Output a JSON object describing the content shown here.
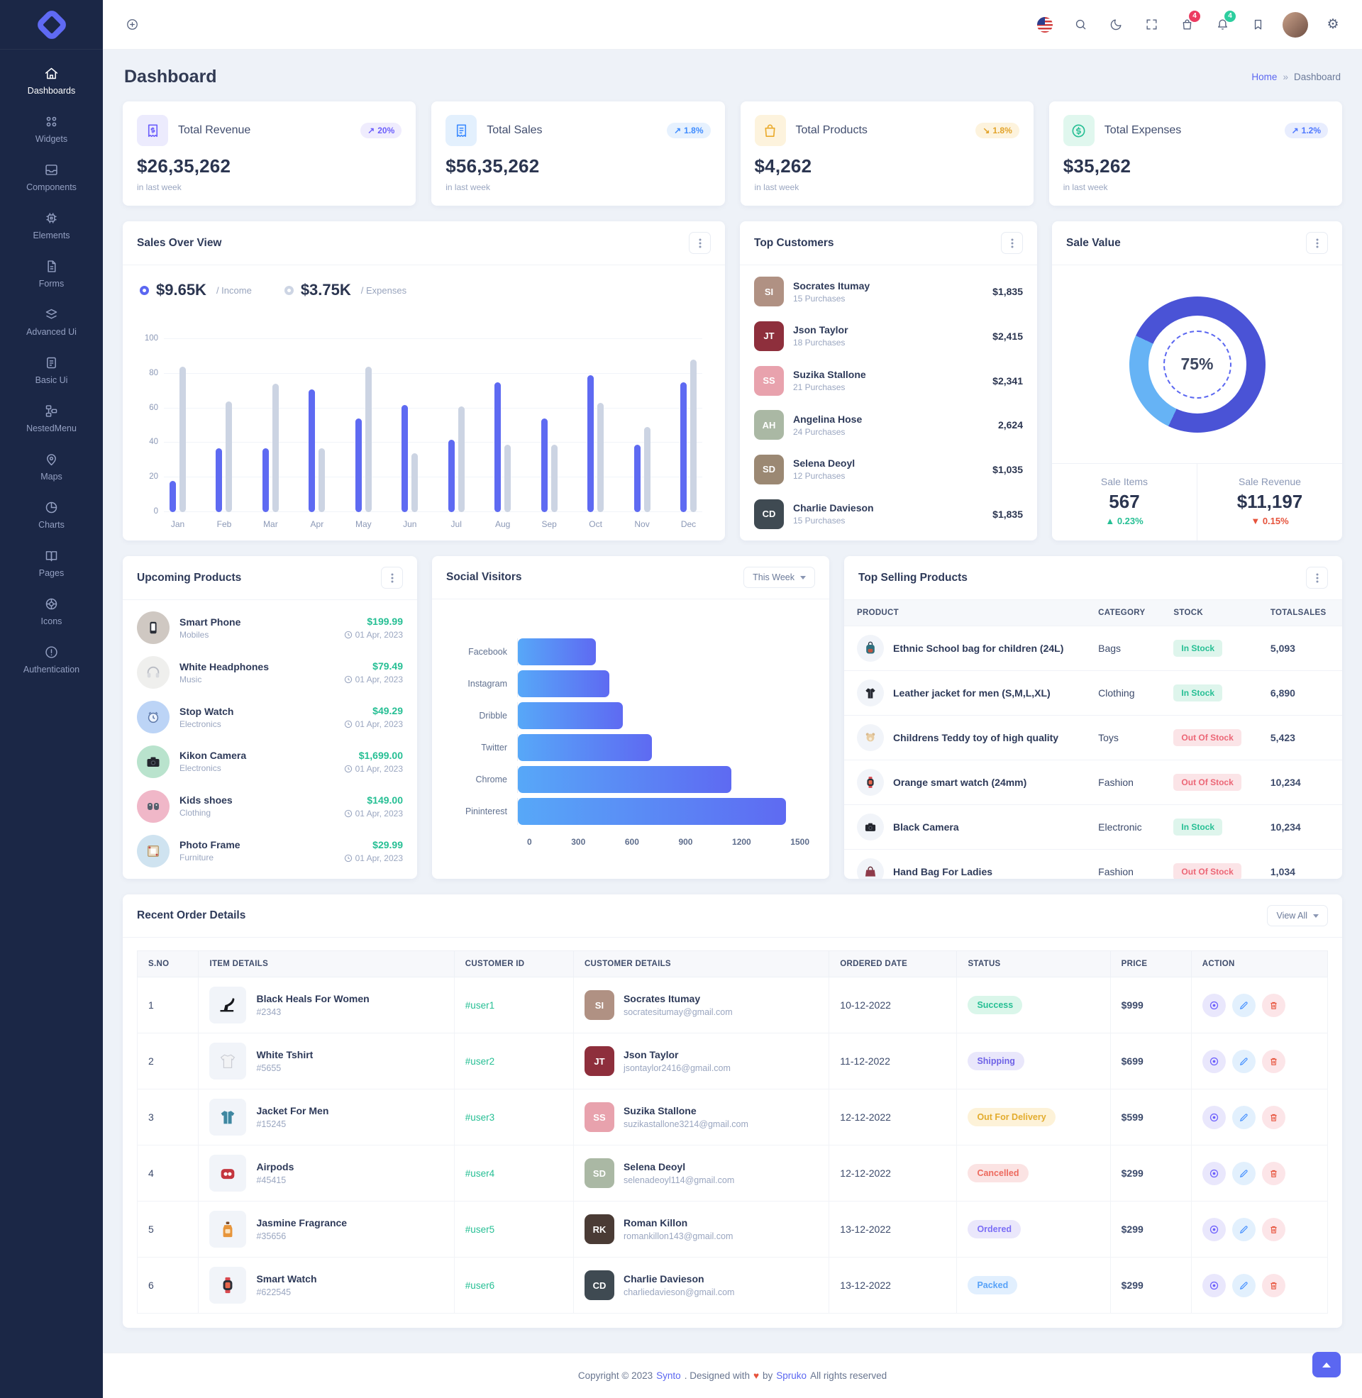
{
  "colors": {
    "primary": "#5b67f1",
    "primary_dark": "#4a53d6",
    "light_blue": "#66b3f5",
    "gray_bar": "#ccd4e3",
    "success": "#26bf94",
    "danger": "#e6533c",
    "warning": "#eaaa2a",
    "info": "#3f8cff",
    "sidebar_bg": "#1b2746"
  },
  "sidebar": {
    "items": [
      {
        "label": "Dashboards"
      },
      {
        "label": "Widgets"
      },
      {
        "label": "Components"
      },
      {
        "label": "Elements"
      },
      {
        "label": "Forms"
      },
      {
        "label": "Advanced Ui"
      },
      {
        "label": "Basic Ui"
      },
      {
        "label": "NestedMenu"
      },
      {
        "label": "Maps"
      },
      {
        "label": "Charts"
      },
      {
        "label": "Pages"
      },
      {
        "label": "Icons"
      },
      {
        "label": "Authentication"
      }
    ]
  },
  "topbar": {
    "cart_badge": "4",
    "notification_badge": "4",
    "gear_glyph": "⚙"
  },
  "page": {
    "title": "Dashboard",
    "breadcrumb_home": "Home",
    "breadcrumb_sep": "»",
    "breadcrumb_current": "Dashboard"
  },
  "stats": [
    {
      "label": "Total Revenue",
      "value": "$26,35,262",
      "note": "in last week",
      "arrow": "↗",
      "badge": "20%"
    },
    {
      "label": "Total Sales",
      "value": "$56,35,262",
      "note": "in last week",
      "arrow": "↗",
      "badge": "1.8%"
    },
    {
      "label": "Total Products",
      "value": "$4,262",
      "note": "in last week",
      "arrow": "↘",
      "badge": "1.8%"
    },
    {
      "label": "Total Expenses",
      "value": "$35,262",
      "note": "in last week",
      "arrow": "↗",
      "badge": "1.2%"
    }
  ],
  "sales_overview": {
    "title": "Sales Over View",
    "income_value": "$9.65K",
    "income_label": "/ Income",
    "expenses_value": "$3.75K",
    "expenses_label": "/ Expenses"
  },
  "chart_data": [
    {
      "type": "bar",
      "title": "Sales Over View",
      "categories": [
        "Jan",
        "Feb",
        "Mar",
        "Apr",
        "May",
        "Jun",
        "Jul",
        "Aug",
        "Sep",
        "Oct",
        "Nov",
        "Dec"
      ],
      "series": [
        {
          "name": "Income",
          "values": [
            18,
            37,
            37,
            71,
            54,
            62,
            42,
            75,
            54,
            79,
            39,
            75
          ]
        },
        {
          "name": "Expenses",
          "values": [
            84,
            64,
            74,
            37,
            84,
            34,
            61,
            39,
            39,
            63,
            49,
            88
          ]
        }
      ],
      "ylim": [
        0,
        100
      ],
      "yticks": [
        0,
        20,
        40,
        60,
        80,
        100
      ],
      "grid": true,
      "legend_position": "top"
    },
    {
      "type": "bar",
      "orientation": "horizontal",
      "title": "Social Visitors",
      "categories": [
        "Facebook",
        "Instagram",
        "Dribble",
        "Twitter",
        "Chrome",
        "Pininterest"
      ],
      "values": [
        400,
        470,
        540,
        690,
        1100,
        1380
      ],
      "xlim": [
        0,
        1500
      ],
      "xticks": [
        0,
        300,
        600,
        900,
        1200,
        1500
      ],
      "grid": false
    }
  ],
  "top_customers": {
    "title": "Top Customers",
    "rows": [
      {
        "name": "Socrates Itumay",
        "purchases": "15 Purchases",
        "amount": "$1,835",
        "initials": "SI",
        "color": "#b09183"
      },
      {
        "name": "Json Taylor",
        "purchases": "18 Purchases",
        "amount": "$2,415",
        "initials": "JT",
        "color": "#8e2f3c"
      },
      {
        "name": "Suzika Stallone",
        "purchases": "21 Purchases",
        "amount": "$2,341",
        "initials": "SS",
        "color": "#e8a2ad"
      },
      {
        "name": "Angelina Hose",
        "purchases": "24 Purchases",
        "amount": "2,624",
        "initials": "AH",
        "color": "#aab8a4"
      },
      {
        "name": "Selena Deoyl",
        "purchases": "12 Purchases",
        "amount": "$1,035",
        "initials": "SD",
        "color": "#9b8873"
      },
      {
        "name": "Charlie Davieson",
        "purchases": "15 Purchases",
        "amount": "$1,835",
        "initials": "CD",
        "color": "#3f4a52"
      }
    ]
  },
  "sale_value": {
    "title": "Sale Value",
    "percent": "75%",
    "items_label": "Sale Items",
    "items_value": "567",
    "items_arrow": "▲",
    "items_delta": "0.23%",
    "revenue_label": "Sale Revenue",
    "revenue_value": "$11,197",
    "revenue_arrow": "▼",
    "revenue_delta": "0.15%"
  },
  "upcoming_products": {
    "title": "Upcoming Products",
    "rows": [
      {
        "name": "Smart Phone",
        "category": "Mobiles",
        "price": "$199.99",
        "date": "01 Apr, 2023",
        "thumb_bg": "#cfc8c2"
      },
      {
        "name": "White Headphones",
        "category": "Music",
        "price": "$79.49",
        "date": "01 Apr, 2023",
        "thumb_bg": "#efefed"
      },
      {
        "name": "Stop Watch",
        "category": "Electronics",
        "price": "$49.29",
        "date": "01 Apr, 2023",
        "thumb_bg": "#bcd4f6"
      },
      {
        "name": "Kikon Camera",
        "category": "Electronics",
        "price": "$1,699.00",
        "date": "01 Apr, 2023",
        "thumb_bg": "#b9e3cd"
      },
      {
        "name": "Kids shoes",
        "category": "Clothing",
        "price": "$149.00",
        "date": "01 Apr, 2023",
        "thumb_bg": "#f0b7c8"
      },
      {
        "name": "Photo Frame",
        "category": "Furniture",
        "price": "$29.99",
        "date": "01 Apr, 2023",
        "thumb_bg": "#cfe3f0"
      }
    ]
  },
  "social_visitors": {
    "title": "Social Visitors",
    "filter_label": "This Week"
  },
  "top_selling": {
    "title": "Top Selling Products",
    "headers": [
      "PRODUCT",
      "CATEGORY",
      "STOCK",
      "TOTALSALES"
    ],
    "rows": [
      {
        "product": "Ethnic School bag for children (24L)",
        "category": "Bags",
        "stock": "In Stock",
        "sales": "5,093"
      },
      {
        "product": "Leather jacket for men (S,M,L,XL)",
        "category": "Clothing",
        "stock": "In Stock",
        "sales": "6,890"
      },
      {
        "product": "Childrens Teddy toy of high quality",
        "category": "Toys",
        "stock": "Out Of Stock",
        "sales": "5,423"
      },
      {
        "product": "Orange smart watch (24mm)",
        "category": "Fashion",
        "stock": "Out Of Stock",
        "sales": "10,234"
      },
      {
        "product": "Black Camera",
        "category": "Electronic",
        "stock": "In Stock",
        "sales": "10,234"
      },
      {
        "product": "Hand Bag For Ladies",
        "category": "Fashion",
        "stock": "Out Of Stock",
        "sales": "1,034"
      }
    ]
  },
  "recent_orders": {
    "title": "Recent Order Details",
    "view_all": "View All",
    "headers": [
      "S.NO",
      "ITEM DETAILS",
      "CUSTOMER ID",
      "CUSTOMER DETAILS",
      "ORDERED DATE",
      "STATUS",
      "PRICE",
      "ACTION"
    ],
    "rows": [
      {
        "sno": "1",
        "item": "Black Heals For Women",
        "item_id": "#2343",
        "customer_id": "#user1",
        "customer": "Socrates Itumay",
        "email": "socratesitumay@gmail.com",
        "date": "10-12-2022",
        "status": "Success",
        "price": "$999",
        "initials": "SI",
        "avatar_color": "#b09183"
      },
      {
        "sno": "2",
        "item": "White Tshirt",
        "item_id": "#5655",
        "customer_id": "#user2",
        "customer": "Json Taylor",
        "email": "jsontaylor2416@gmail.com",
        "date": "11-12-2022",
        "status": "Shipping",
        "price": "$699",
        "initials": "JT",
        "avatar_color": "#8e2f3c"
      },
      {
        "sno": "3",
        "item": "Jacket For Men",
        "item_id": "#15245",
        "customer_id": "#user3",
        "customer": "Suzika Stallone",
        "email": "suzikastallone3214@gmail.com",
        "date": "12-12-2022",
        "status": "Out For Delivery",
        "price": "$599",
        "initials": "SS",
        "avatar_color": "#e8a2ad"
      },
      {
        "sno": "4",
        "item": "Airpods",
        "item_id": "#45415",
        "customer_id": "#user4",
        "customer": "Selena Deoyl",
        "email": "selenadeoyl114@gmail.com",
        "date": "12-12-2022",
        "status": "Cancelled",
        "price": "$299",
        "initials": "SD",
        "avatar_color": "#aab8a4"
      },
      {
        "sno": "5",
        "item": "Jasmine Fragrance",
        "item_id": "#35656",
        "customer_id": "#user5",
        "customer": "Roman Killon",
        "email": "romankillon143@gmail.com",
        "date": "13-12-2022",
        "status": "Ordered",
        "price": "$299",
        "initials": "RK",
        "avatar_color": "#4a3b35"
      },
      {
        "sno": "6",
        "item": "Smart Watch",
        "item_id": "#622545",
        "customer_id": "#user6",
        "customer": "Charlie Davieson",
        "email": "charliedavieson@gmail.com",
        "date": "13-12-2022",
        "status": "Packed",
        "price": "$299",
        "initials": "CD",
        "avatar_color": "#3f4a52"
      }
    ]
  },
  "footer": {
    "prefix": "Copyright © 2023",
    "brand": "Synto",
    "mid": ". Designed with",
    "heart": "♥",
    "by": "by",
    "brand2": "Spruko",
    "suffix": "All rights reserved"
  }
}
